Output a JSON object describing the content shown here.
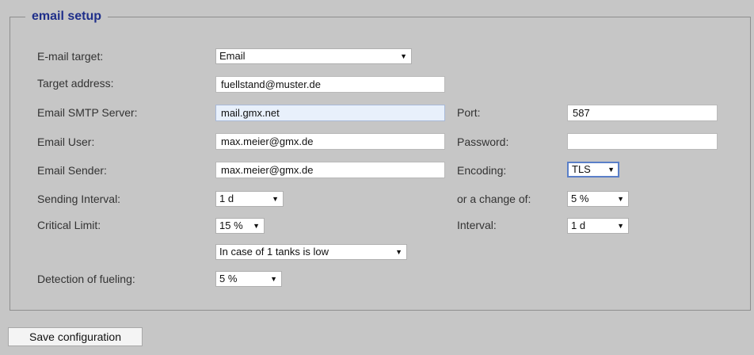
{
  "fieldset": {
    "legend": "email setup"
  },
  "labels": {
    "email_target": "E-mail target:",
    "target_address": "Target address:",
    "smtp_server": "Email SMTP Server:",
    "email_user": "Email User:",
    "email_sender": "Email Sender:",
    "sending_interval": "Sending Interval:",
    "critical_limit": "Critical Limit:",
    "detection_fueling": "Detection of fueling:",
    "port": "Port:",
    "password": "Password:",
    "encoding": "Encoding:",
    "change_of": "or a change of:",
    "interval": "Interval:"
  },
  "fields": {
    "email_target": "Email",
    "target_address": "fuellstand@muster.de",
    "smtp_server": "mail.gmx.net",
    "email_user": "max.meier@gmx.de",
    "email_sender": "max.meier@gmx.de",
    "sending_interval": "1 d",
    "critical_limit": "15 %",
    "tanks_low": "In case of 1 tanks is low",
    "detection_fueling": "5 %",
    "port": "587",
    "password": "",
    "encoding": "TLS",
    "change_of": "5 %",
    "interval": "1 d"
  },
  "icons": {
    "dropdown_arrow": "▼"
  },
  "buttons": {
    "save": "Save configuration"
  },
  "colors": {
    "legend": "#1f2f8a",
    "background": "#c6c6c6"
  }
}
